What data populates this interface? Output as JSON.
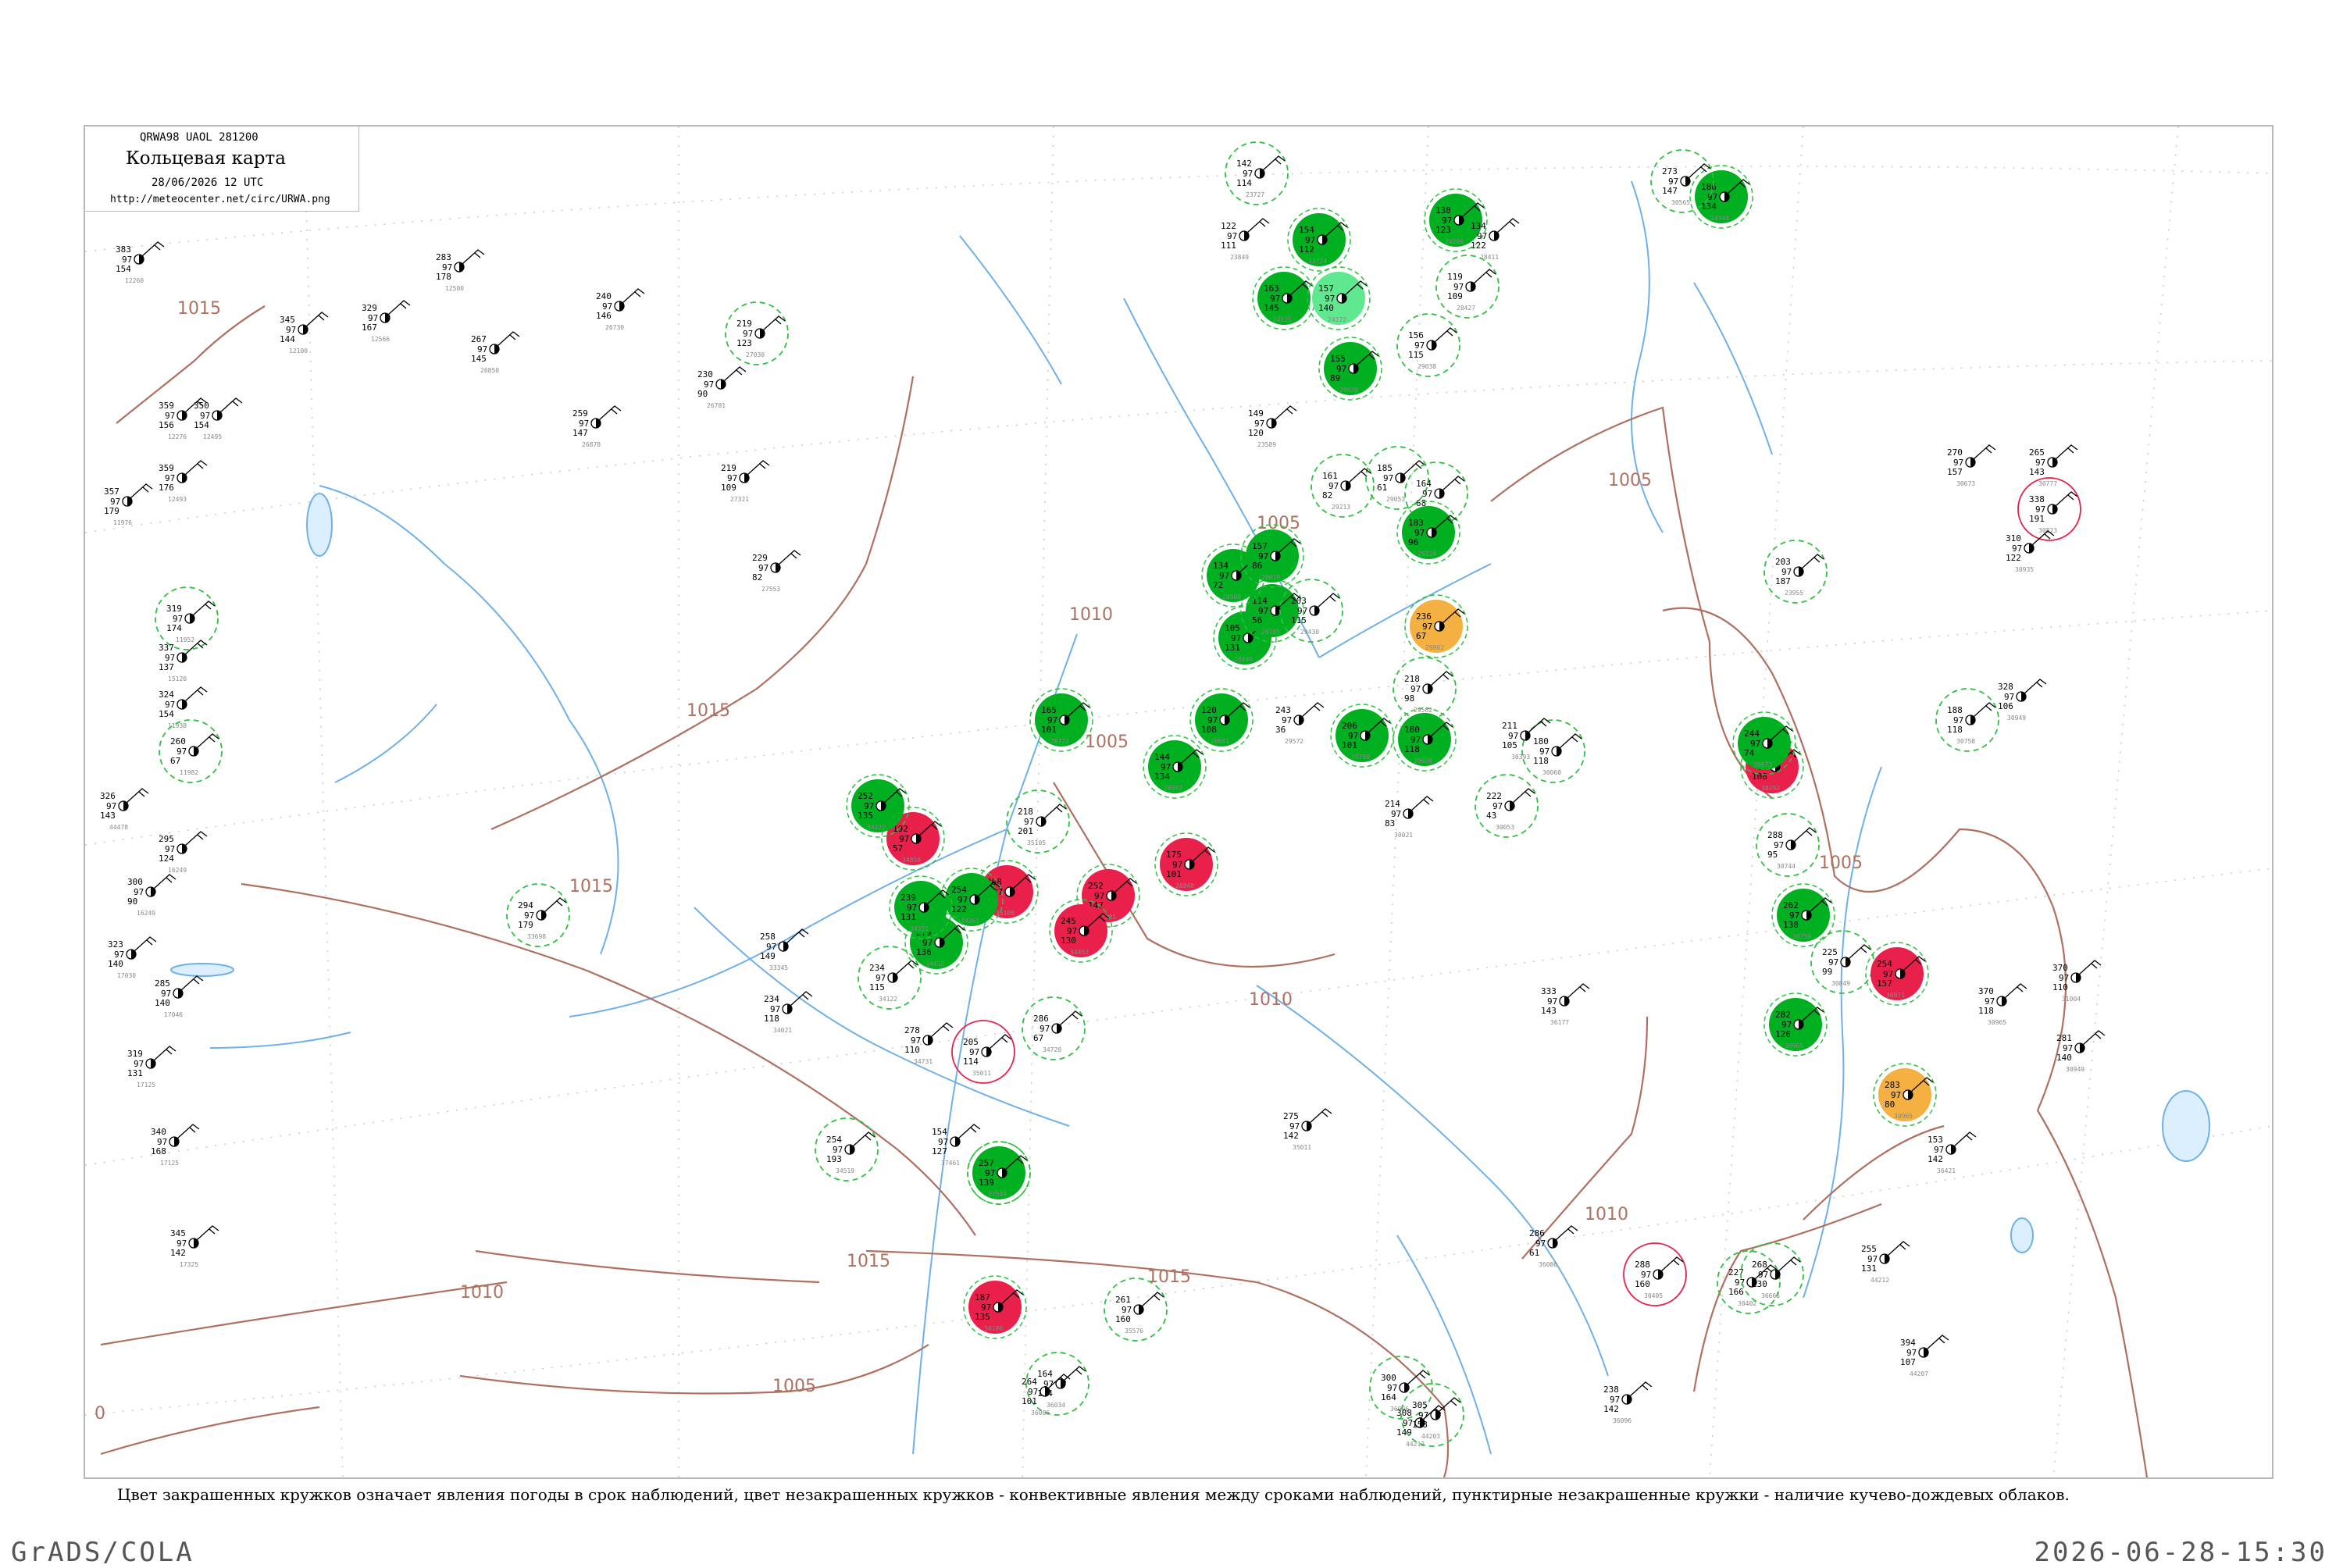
{
  "header": {
    "code_line": "QRWA98 UAOL 281200",
    "title": "Кольцевая карта",
    "datetime": "28/06/2026 12 UTC",
    "url": "http://meteocenter.net/circ/URWA.png"
  },
  "caption": "Цвет закрашенных кружков означает явления погоды в срок наблюдений, цвет незакрашенных кружков - конвективные явления между сроками наблюдений, пунктирные незакрашенные кружки - наличие кучево-дождевых облаков.",
  "footer": {
    "credit": "GrADS/COLA",
    "timestamp": "2026-06-28-15:30"
  },
  "colors": {
    "rain": "#00b020",
    "thunder": "#e8204a",
    "haze": "#f4b040",
    "light": "#60e890",
    "isobar": "#b07060",
    "river": "#70b0e8",
    "dashed_ring": "#30c040"
  },
  "isobar_labels": [
    "1015",
    "1015",
    "1015",
    "1015",
    "1015",
    "1010",
    "1010",
    "1010",
    "1010",
    "1005",
    "1005",
    "1005",
    "1005",
    "1005",
    "0"
  ],
  "stations": [
    {
      "p": "359",
      "t": "97",
      "v": "156",
      "id": "12276",
      "fill": "none",
      "ring": "none"
    },
    {
      "p": "350",
      "t": "97",
      "v": "154",
      "id": "12495",
      "fill": "none",
      "ring": "none"
    },
    {
      "p": "359",
      "t": "97",
      "v": "176",
      "id": "12493",
      "fill": "none",
      "ring": "none"
    },
    {
      "p": "357",
      "t": "97",
      "v": "179",
      "id": "11976",
      "fill": "none",
      "ring": "none"
    },
    {
      "p": "319",
      "t": "97",
      "v": "174",
      "id": "11952",
      "fill": "none",
      "ring": "dashed"
    },
    {
      "p": "337",
      "t": "97",
      "v": "137",
      "id": "15120",
      "fill": "none",
      "ring": "none"
    },
    {
      "p": "324",
      "t": "97",
      "v": "154",
      "id": "11938",
      "fill": "none",
      "ring": "none"
    },
    {
      "p": "260",
      "t": "97",
      "v": "67",
      "id": "11982",
      "fill": "none",
      "ring": "dashed"
    },
    {
      "p": "326",
      "t": "97",
      "v": "143",
      "id": "44478",
      "fill": "none",
      "ring": "none"
    },
    {
      "p": "295",
      "t": "97",
      "v": "124",
      "id": "16249",
      "fill": "none",
      "ring": "none"
    },
    {
      "p": "300",
      "t": "97",
      "v": "90",
      "id": "16249",
      "fill": "none",
      "ring": "none"
    },
    {
      "p": "323",
      "t": "97",
      "v": "140",
      "id": "17030",
      "fill": "none",
      "ring": "none"
    },
    {
      "p": "285",
      "t": "97",
      "v": "140",
      "id": "17046",
      "fill": "none",
      "ring": "none"
    },
    {
      "p": "319",
      "t": "97",
      "v": "131",
      "id": "17125",
      "fill": "none",
      "ring": "none"
    },
    {
      "p": "340",
      "t": "97",
      "v": "168",
      "id": "17125",
      "fill": "none",
      "ring": "none"
    },
    {
      "p": "345",
      "t": "97",
      "v": "142",
      "id": "17325",
      "fill": "none",
      "ring": "none"
    },
    {
      "p": "383",
      "t": "97",
      "v": "154",
      "id": "12260",
      "fill": "none",
      "ring": "none"
    },
    {
      "p": "345",
      "t": "97",
      "v": "144",
      "id": "12100",
      "fill": "none",
      "ring": "none"
    },
    {
      "p": "329",
      "t": "97",
      "v": "167",
      "id": "12566",
      "fill": "none",
      "ring": "none"
    },
    {
      "p": "283",
      "t": "97",
      "v": "178",
      "id": "12500",
      "fill": "none",
      "ring": "none"
    },
    {
      "p": "267",
      "t": "97",
      "v": "145",
      "id": "26850",
      "fill": "none",
      "ring": "none"
    },
    {
      "p": "259",
      "t": "97",
      "v": "147",
      "id": "26878",
      "fill": "none",
      "ring": "none"
    },
    {
      "p": "240",
      "t": "97",
      "v": "146",
      "id": "26730",
      "fill": "none",
      "ring": "none"
    },
    {
      "p": "230",
      "t": "97",
      "v": "90",
      "id": "26781",
      "fill": "none",
      "ring": "none"
    },
    {
      "p": "219",
      "t": "97",
      "v": "123",
      "id": "27030",
      "fill": "none",
      "ring": "dashed"
    },
    {
      "p": "219",
      "t": "97",
      "v": "109",
      "id": "27321",
      "fill": "none",
      "ring": "none"
    },
    {
      "p": "229",
      "t": "97",
      "v": "82",
      "id": "27553",
      "fill": "none",
      "ring": "none"
    },
    {
      "p": "294",
      "t": "97",
      "v": "179",
      "id": "33698",
      "fill": "none",
      "ring": "dashed"
    },
    {
      "p": "258",
      "t": "97",
      "v": "149",
      "id": "33345",
      "fill": "none",
      "ring": "none"
    },
    {
      "p": "234",
      "t": "97",
      "v": "118",
      "id": "34021",
      "fill": "none",
      "ring": "none"
    },
    {
      "p": "234",
      "t": "97",
      "v": "115",
      "id": "34122",
      "fill": "none",
      "ring": "dashed"
    },
    {
      "p": "254",
      "t": "97",
      "v": "193",
      "id": "34519",
      "fill": "none",
      "ring": "dashed"
    },
    {
      "p": "278",
      "t": "97",
      "v": "110",
      "id": "34731",
      "fill": "none",
      "ring": "none"
    },
    {
      "p": "286",
      "t": "97",
      "v": "67",
      "id": "34720",
      "fill": "none",
      "ring": "dashed"
    },
    {
      "p": "154",
      "t": "97",
      "v": "127",
      "id": "37461",
      "fill": "none",
      "ring": "none"
    },
    {
      "p": "257",
      "t": "97",
      "v": "139",
      "id": "37549",
      "fill": "rain",
      "ring": "dashed"
    },
    {
      "p": "187",
      "t": "97",
      "v": "135",
      "id": "34186",
      "fill": "thunder",
      "ring": "none"
    },
    {
      "p": "192",
      "t": "97",
      "v": "57",
      "id": "34858",
      "fill": "thunder",
      "ring": "none"
    },
    {
      "p": "208",
      "t": "97",
      "v": "84",
      "id": "35108",
      "fill": "thunder",
      "ring": "none"
    },
    {
      "p": "252",
      "t": "97",
      "v": "147",
      "id": "34581",
      "fill": "thunder",
      "ring": "none"
    },
    {
      "p": "245",
      "t": "97",
      "v": "130",
      "id": "34452",
      "fill": "thunder",
      "ring": "none"
    },
    {
      "p": "254",
      "t": "97",
      "v": "122",
      "id": "34361",
      "fill": "rain",
      "ring": "none"
    },
    {
      "p": "279",
      "t": "97",
      "v": "136",
      "id": "34415",
      "fill": "rain",
      "ring": "none"
    },
    {
      "p": "252",
      "t": "97",
      "v": "135",
      "id": "34122",
      "fill": "rain",
      "ring": "none"
    },
    {
      "p": "239",
      "t": "97",
      "v": "131",
      "id": "34321",
      "fill": "rain",
      "ring": "none"
    },
    {
      "p": "205",
      "t": "97",
      "v": "114",
      "id": "35011",
      "fill": "none",
      "ring": "solid-red"
    },
    {
      "p": "218",
      "t": "97",
      "v": "201",
      "id": "35105",
      "fill": "none",
      "ring": "dashed"
    },
    {
      "p": "165",
      "t": "97",
      "v": "101",
      "id": "28722",
      "fill": "rain",
      "ring": "none"
    },
    {
      "p": "120",
      "t": "97",
      "v": "108",
      "id": "28661",
      "fill": "rain",
      "ring": "none"
    },
    {
      "p": "175",
      "t": "97",
      "v": "101",
      "id": "28848",
      "fill": "thunder",
      "ring": "none"
    },
    {
      "p": "144",
      "t": "97",
      "v": "134",
      "id": "28552",
      "fill": "rain",
      "ring": "none"
    },
    {
      "p": "105",
      "t": "97",
      "v": "131",
      "id": "28440",
      "fill": "rain",
      "ring": "none"
    },
    {
      "p": "114",
      "t": "97",
      "v": "56",
      "id": "28785",
      "fill": "rain",
      "ring": "none"
    },
    {
      "p": "134",
      "t": "97",
      "v": "72",
      "id": "28900",
      "fill": "rain",
      "ring": "none"
    },
    {
      "p": "157",
      "t": "97",
      "v": "86",
      "id": "28610",
      "fill": "rain",
      "ring": "none"
    },
    {
      "p": "149",
      "t": "97",
      "v": "120",
      "id": "23589",
      "fill": "none",
      "ring": "none"
    },
    {
      "p": "142",
      "t": "97",
      "v": "114",
      "id": "23727",
      "fill": "none",
      "ring": "dashed"
    },
    {
      "p": "122",
      "t": "97",
      "v": "111",
      "id": "23849",
      "fill": "none",
      "ring": "none"
    },
    {
      "p": "154",
      "t": "97",
      "v": "112",
      "id": "23724",
      "fill": "rain",
      "ring": "none"
    },
    {
      "p": "163",
      "t": "97",
      "v": "145",
      "id": "24125",
      "fill": "rain",
      "ring": "none"
    },
    {
      "p": "157",
      "t": "97",
      "v": "140",
      "id": "24122",
      "fill": "light",
      "ring": "none"
    },
    {
      "p": "138",
      "t": "97",
      "v": "123",
      "id": "24266",
      "fill": "rain",
      "ring": "none"
    },
    {
      "p": "134",
      "t": "97",
      "v": "122",
      "id": "28411",
      "fill": "none",
      "ring": "none"
    },
    {
      "p": "119",
      "t": "97",
      "v": "109",
      "id": "28427",
      "fill": "none",
      "ring": "dashed"
    },
    {
      "p": "156",
      "t": "97",
      "v": "115",
      "id": "29038",
      "fill": "none",
      "ring": "dashed"
    },
    {
      "p": "155",
      "t": "97",
      "v": "89",
      "id": "29030",
      "fill": "rain",
      "ring": "none"
    },
    {
      "p": "185",
      "t": "97",
      "v": "61",
      "id": "29053",
      "fill": "none",
      "ring": "dashed"
    },
    {
      "p": "164",
      "t": "97",
      "v": "68",
      "id": "29130",
      "fill": "none",
      "ring": "dashed"
    },
    {
      "p": "161",
      "t": "97",
      "v": "82",
      "id": "29213",
      "fill": "none",
      "ring": "dashed"
    },
    {
      "p": "183",
      "t": "97",
      "v": "96",
      "id": "29320",
      "fill": "rain",
      "ring": "none"
    },
    {
      "p": "203",
      "t": "97",
      "v": "115",
      "id": "29430",
      "fill": "none",
      "ring": "dashed"
    },
    {
      "p": "218",
      "t": "97",
      "v": "98",
      "id": "29562",
      "fill": "none",
      "ring": "dashed"
    },
    {
      "p": "180",
      "t": "97",
      "v": "118",
      "id": "29698",
      "fill": "rain",
      "ring": "none"
    },
    {
      "p": "206",
      "t": "97",
      "v": "101",
      "id": "29798",
      "fill": "rain",
      "ring": "none"
    },
    {
      "p": "236",
      "t": "97",
      "v": "67",
      "id": "29862",
      "fill": "haze",
      "ring": "none"
    },
    {
      "p": "243",
      "t": "97",
      "v": "36",
      "id": "29572",
      "fill": "none",
      "ring": "none"
    },
    {
      "p": "214",
      "t": "97",
      "v": "83",
      "id": "30021",
      "fill": "none",
      "ring": "none"
    },
    {
      "p": "222",
      "t": "97",
      "v": "43",
      "id": "30053",
      "fill": "none",
      "ring": "dashed"
    },
    {
      "p": "180",
      "t": "97",
      "v": "118",
      "id": "30060",
      "fill": "none",
      "ring": "dashed"
    },
    {
      "p": "211",
      "t": "97",
      "v": "105",
      "id": "30393",
      "fill": "none",
      "ring": "none"
    },
    {
      "p": "240",
      "t": "97",
      "v": "108",
      "id": "30252",
      "fill": "thunder",
      "ring": "none"
    },
    {
      "p": "203",
      "t": "97",
      "v": "187",
      "id": "23955",
      "fill": "none",
      "ring": "dashed"
    },
    {
      "p": "186",
      "t": "97",
      "v": "134",
      "id": "24344",
      "fill": "rain",
      "ring": "none"
    },
    {
      "p": "273",
      "t": "97",
      "v": "147",
      "id": "30565",
      "fill": "none",
      "ring": "dashed"
    },
    {
      "p": "270",
      "t": "97",
      "v": "157",
      "id": "30673",
      "fill": "none",
      "ring": "none"
    },
    {
      "p": "265",
      "t": "97",
      "v": "143",
      "id": "30777",
      "fill": "none",
      "ring": "none"
    },
    {
      "p": "338",
      "t": "97",
      "v": "191",
      "id": "30823",
      "fill": "none",
      "ring": "solid-red"
    },
    {
      "p": "310",
      "t": "97",
      "v": "122",
      "id": "30935",
      "fill": "none",
      "ring": "none"
    },
    {
      "p": "328",
      "t": "97",
      "v": "106",
      "id": "30949",
      "fill": "none",
      "ring": "none"
    },
    {
      "p": "188",
      "t": "97",
      "v": "118",
      "id": "30758",
      "fill": "none",
      "ring": "dashed"
    },
    {
      "p": "244",
      "t": "97",
      "v": "74",
      "id": "30673",
      "fill": "rain",
      "ring": "none"
    },
    {
      "p": "288",
      "t": "97",
      "v": "95",
      "id": "30744",
      "fill": "none",
      "ring": "dashed"
    },
    {
      "p": "262",
      "t": "97",
      "v": "138",
      "id": "30758",
      "fill": "rain",
      "ring": "none"
    },
    {
      "p": "225",
      "t": "97",
      "v": "99",
      "id": "30849",
      "fill": "none",
      "ring": "dashed"
    },
    {
      "p": "282",
      "t": "97",
      "v": "126",
      "id": "30965",
      "fill": "rain",
      "ring": "none"
    },
    {
      "p": "254",
      "t": "97",
      "v": "157",
      "id": "30971",
      "fill": "thunder",
      "ring": "none"
    },
    {
      "p": "370",
      "t": "97",
      "v": "118",
      "id": "30965",
      "fill": "none",
      "ring": "none"
    },
    {
      "p": "370",
      "t": "97",
      "v": "110",
      "id": "31004",
      "fill": "none",
      "ring": "none"
    },
    {
      "p": "281",
      "t": "97",
      "v": "140",
      "id": "30949",
      "fill": "none",
      "ring": "none"
    },
    {
      "p": "283",
      "t": "97",
      "v": "80",
      "id": "30965",
      "fill": "haze",
      "ring": "none"
    },
    {
      "p": "153",
      "t": "97",
      "v": "142",
      "id": "36421",
      "fill": "none",
      "ring": "none"
    },
    {
      "p": "333",
      "t": "97",
      "v": "143",
      "id": "36177",
      "fill": "none",
      "ring": "none"
    },
    {
      "p": "275",
      "t": "97",
      "v": "142",
      "id": "35011",
      "fill": "none",
      "ring": "none"
    },
    {
      "p": "286",
      "t": "97",
      "v": "61",
      "id": "36086",
      "fill": "none",
      "ring": "none"
    },
    {
      "p": "288",
      "t": "97",
      "v": "160",
      "id": "30405",
      "fill": "none",
      "ring": "solid-red"
    },
    {
      "p": "227",
      "t": "97",
      "v": "166",
      "id": "30402",
      "fill": "none",
      "ring": "dashed"
    },
    {
      "p": "268",
      "t": "97",
      "v": "130",
      "id": "36665",
      "fill": "none",
      "ring": "dashed"
    },
    {
      "p": "238",
      "t": "97",
      "v": "142",
      "id": "36096",
      "fill": "none",
      "ring": "none"
    },
    {
      "p": "300",
      "t": "97",
      "v": "164",
      "id": "36096",
      "fill": "none",
      "ring": "dashed"
    },
    {
      "p": "308",
      "t": "97",
      "v": "149",
      "id": "44212",
      "fill": "none",
      "ring": "none"
    },
    {
      "p": "305",
      "t": "97",
      "v": "158",
      "id": "44203",
      "fill": "none",
      "ring": "dashed"
    },
    {
      "p": "394",
      "t": "97",
      "v": "107",
      "id": "44207",
      "fill": "none",
      "ring": "none"
    },
    {
      "p": "255",
      "t": "97",
      "v": "131",
      "id": "44212",
      "fill": "none",
      "ring": "none"
    },
    {
      "p": "261",
      "t": "97",
      "v": "160",
      "id": "35576",
      "fill": "none",
      "ring": "dashed"
    },
    {
      "p": "164",
      "t": "97",
      "v": "174",
      "id": "36034",
      "fill": "none",
      "ring": "dashed"
    },
    {
      "p": "264",
      "t": "97",
      "v": "101",
      "id": "36086",
      "fill": "none",
      "ring": "none"
    }
  ]
}
